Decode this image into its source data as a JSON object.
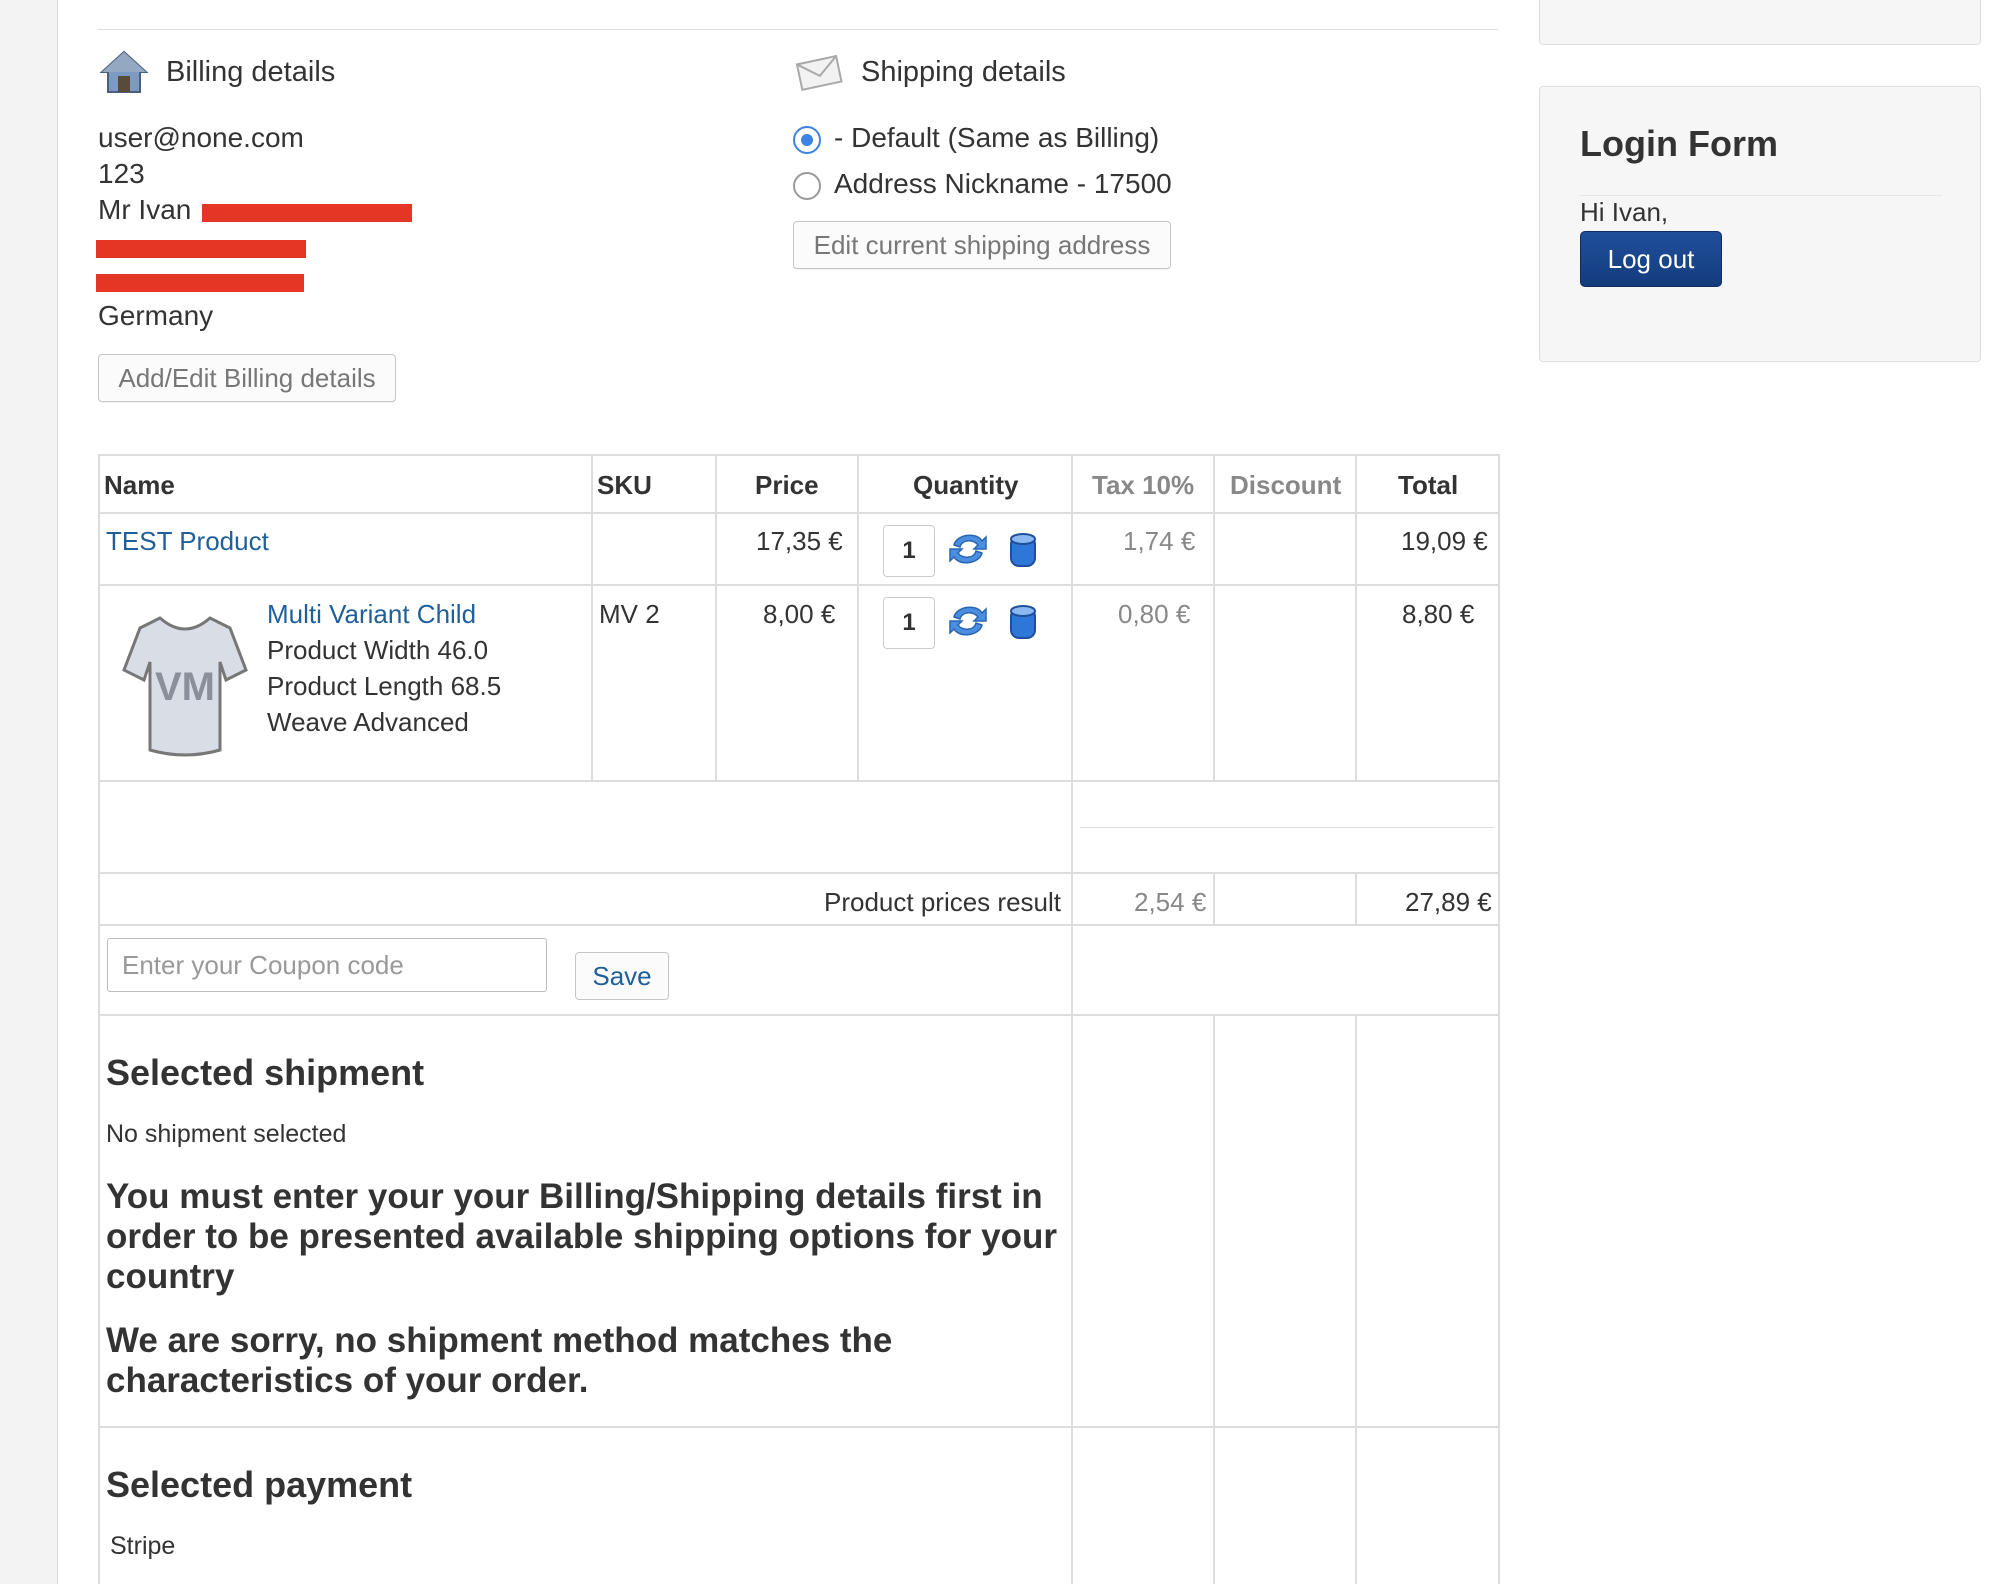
{
  "billing": {
    "title": "Billing details",
    "email": "user@none.com",
    "line2": "123",
    "name": "Mr Ivan",
    "country": "Germany",
    "edit_button": "Add/Edit Billing details"
  },
  "shipping": {
    "title": "Shipping details",
    "option_default": "- Default (Same as Billing)",
    "option_nickname": "Address Nickname - 17500",
    "edit_button": "Edit current shipping address"
  },
  "login": {
    "title": "Login Form",
    "greeting": "Hi Ivan,",
    "logout_button": "Log out"
  },
  "cart": {
    "headers": {
      "name": "Name",
      "sku": "SKU",
      "price": "Price",
      "quantity": "Quantity",
      "tax": "Tax 10%",
      "discount": "Discount",
      "total": "Total"
    },
    "items": [
      {
        "name": "TEST Product",
        "sku": "",
        "price": "17,35 €",
        "quantity": "1",
        "tax": "1,74 €",
        "discount": "",
        "total": "19,09 €"
      },
      {
        "name": "Multi Variant Child",
        "attr1": "Product Width 46.0",
        "attr2": "Product Length 68.5",
        "attr3": "Weave Advanced",
        "sku": "MV 2",
        "price": "8,00 €",
        "quantity": "1",
        "tax": "0,80 €",
        "discount": "",
        "total": "8,80 €",
        "thumb_text": "VM"
      }
    ],
    "result_label": "Product prices result",
    "result_tax": "2,54 €",
    "result_total": "27,89 €",
    "coupon_placeholder": "Enter your Coupon code",
    "coupon_save": "Save"
  },
  "shipment": {
    "title": "Selected shipment",
    "status": "No shipment selected",
    "warning1": "You must enter your your Billing/Shipping details first in order to be presented available shipping options for your country",
    "warning2": "We are sorry, no shipment method matches the characteristics of your order."
  },
  "payment": {
    "title": "Selected payment",
    "method": "Stripe"
  },
  "colors": {
    "link": "#1f5f9a",
    "accent_radio": "#3b84e2",
    "logout_bg": "#1a468d",
    "redaction": "#e53524"
  }
}
